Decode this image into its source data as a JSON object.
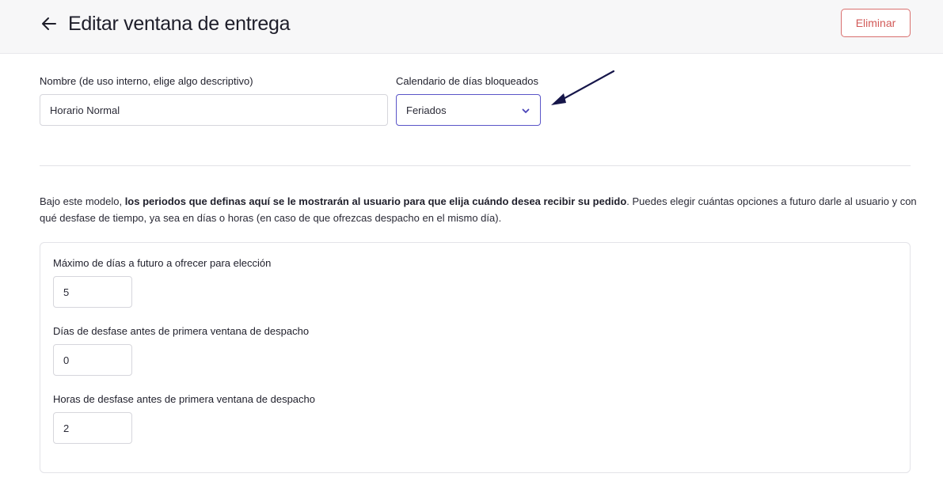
{
  "header": {
    "title": "Editar ventana de entrega",
    "delete_label": "Eliminar",
    "back_icon": "arrow-left-icon"
  },
  "form": {
    "name": {
      "label": "Nombre (de uso interno, elige algo descriptivo)",
      "value": "Horario Normal"
    },
    "calendar": {
      "label": "Calendario de días bloqueados",
      "selected": "Feriados",
      "icon": "chevron-down-icon"
    }
  },
  "description": {
    "intro": "Bajo este modelo, ",
    "bold": "los periodos que definas aquí se le mostrarán al usuario para que elija cuándo desea recibir su pedido",
    "rest": ". Puedes elegir cuántas opciones a futuro darle al usuario y con qué desfase de tiempo, ya sea en días o horas (en caso de que ofrezcas despacho en el mismo día)."
  },
  "settings": {
    "max_days": {
      "label": "Máximo de días a futuro a ofrecer para elección",
      "value": "5"
    },
    "offset_days": {
      "label": "Días de desfase antes de primera ventana de despacho",
      "value": "0"
    },
    "offset_hours": {
      "label": "Horas de desfase antes de primera ventana de despacho",
      "value": "2"
    }
  },
  "colors": {
    "accent": "#5a55c8",
    "danger": "#d25a58",
    "annotation": "#16164a"
  }
}
